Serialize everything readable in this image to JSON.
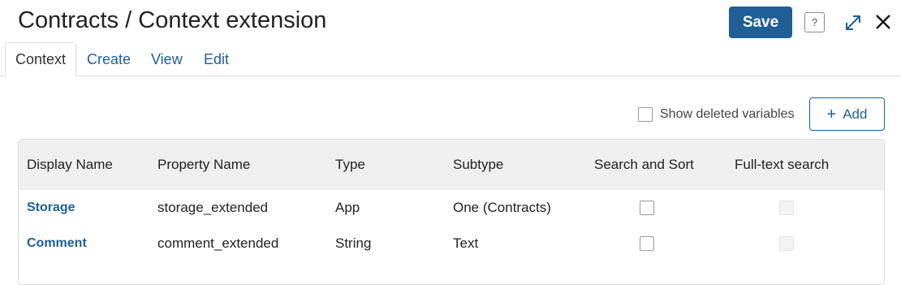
{
  "header": {
    "title": "Contracts / Context extension",
    "save_label": "Save",
    "help_label": "?"
  },
  "tabs": [
    {
      "label": "Context",
      "active": true
    },
    {
      "label": "Create",
      "active": false
    },
    {
      "label": "View",
      "active": false
    },
    {
      "label": "Edit",
      "active": false
    }
  ],
  "toolbar": {
    "show_deleted_label": "Show deleted variables",
    "show_deleted_checked": false,
    "add_label": "Add"
  },
  "table": {
    "columns": [
      "Display Name",
      "Property Name",
      "Type",
      "Subtype",
      "Search and Sort",
      "Full-text search"
    ],
    "rows": [
      {
        "display_name": "Storage",
        "property_name": "storage_extended",
        "type": "App",
        "subtype": "One (Contracts)",
        "search_sort": false,
        "full_text": false
      },
      {
        "display_name": "Comment",
        "property_name": "comment_extended",
        "type": "String",
        "subtype": "Text",
        "search_sort": false,
        "full_text": false
      }
    ]
  },
  "colors": {
    "accent": "#1f5f96",
    "header_bg": "#efefef",
    "border": "#dcdcdc"
  },
  "icons": {
    "help": "help-icon",
    "expand": "expand-icon",
    "close": "close-icon",
    "add": "plus-icon"
  }
}
